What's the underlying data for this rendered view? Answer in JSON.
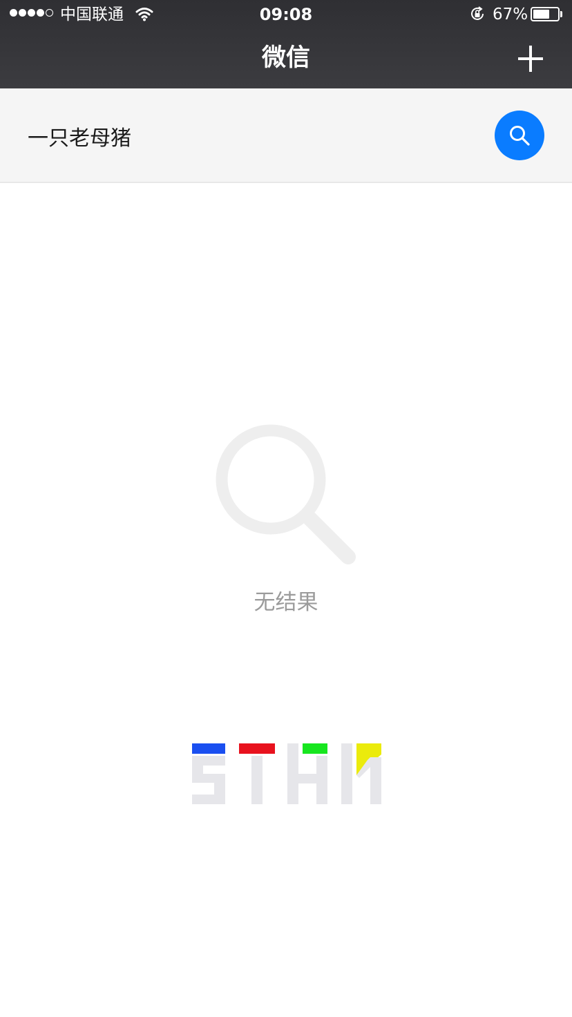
{
  "status_bar": {
    "carrier": "中国联通",
    "time": "09:08",
    "battery_percent": "67%",
    "battery_level": 0.67,
    "signal_bars_filled": 4,
    "signal_bars_total": 5
  },
  "nav": {
    "title": "微信",
    "add_icon": "plus-icon"
  },
  "search": {
    "query": "一只老母猪",
    "button_icon": "search-icon",
    "accent_color": "#0a7cff"
  },
  "empty_state": {
    "icon": "magnifier-icon",
    "message": "无结果"
  },
  "logo": {
    "colors": [
      "#1a4ff0",
      "#e8121e",
      "#17e61f",
      "#ebeb0c"
    ]
  }
}
